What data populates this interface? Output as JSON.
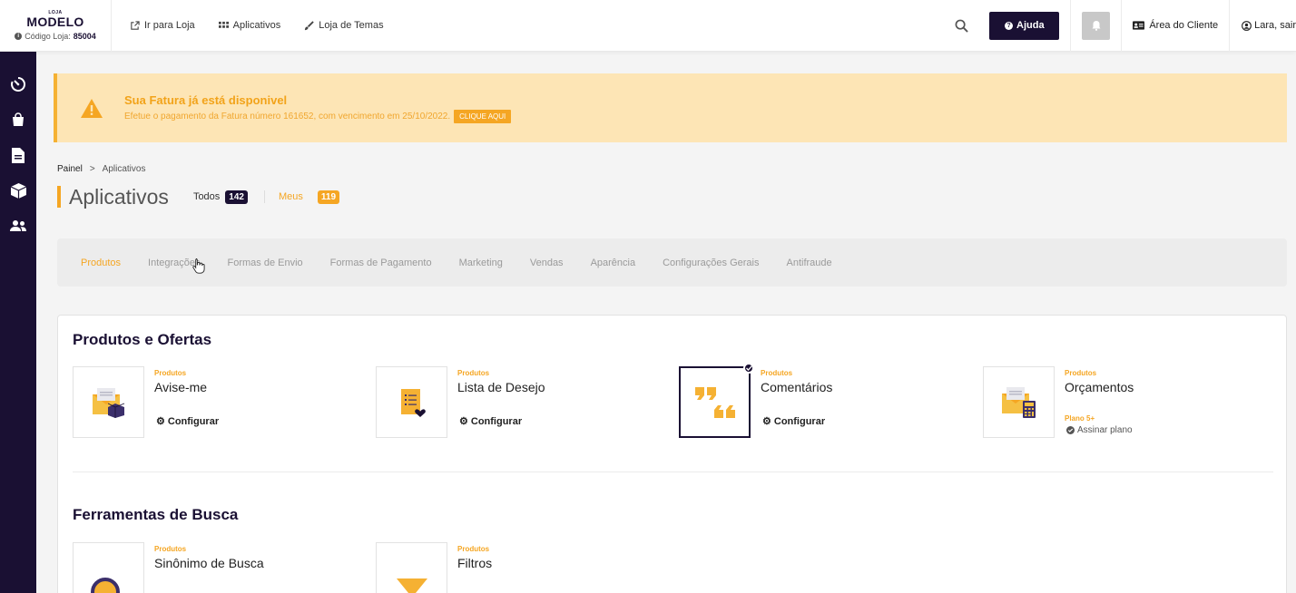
{
  "brand": {
    "small": "LOJA",
    "name": "MODELO",
    "code_label": "Código Loja:",
    "code_value": "85004"
  },
  "nav": [
    {
      "label": "Ir para Loja",
      "icon": "external-link-icon"
    },
    {
      "label": "Aplicativos",
      "icon": "grid-icon"
    },
    {
      "label": "Loja de Temas",
      "icon": "brush-icon"
    }
  ],
  "header": {
    "help_label": "Ajuda",
    "client_area_label": "Área do Cliente",
    "user_label": "Lara, sair"
  },
  "sidebar": {
    "icons": [
      "timer-icon",
      "shopping-bag-icon",
      "document-icon",
      "box-icon",
      "users-icon"
    ]
  },
  "alert": {
    "title": "Sua Fatura já está disponivel",
    "body": "Efetue o pagamento da Fatura número 161652, com vencimento em 25/10/2022.",
    "button": "CLIQUE AQUI"
  },
  "breadcrumb": {
    "home": "Painel",
    "separator": ">",
    "current": "Aplicativos"
  },
  "page": {
    "title": "Aplicativos",
    "all_label": "Todos",
    "all_count": "142",
    "mine_label": "Meus",
    "mine_count": "119"
  },
  "tabs": [
    "Produtos",
    "Integrações",
    "Formas de Envio",
    "Formas de Pagamento",
    "Marketing",
    "Vendas",
    "Aparência",
    "Configurações Gerais",
    "Antifraude"
  ],
  "sections": [
    {
      "title": "Produtos e Ofertas",
      "apps": [
        {
          "category": "Produtos",
          "name": "Avise-me",
          "action": "Configurar"
        },
        {
          "category": "Produtos",
          "name": "Lista de Desejo",
          "action": "Configurar"
        },
        {
          "category": "Produtos",
          "name": "Comentários",
          "action": "Configurar"
        },
        {
          "category": "Produtos",
          "name": "Orçamentos",
          "plan": "Plano 5+",
          "subscribe": "Assinar plano"
        }
      ]
    },
    {
      "title": "Ferramentas de Busca",
      "apps": [
        {
          "category": "Produtos",
          "name": "Sinônimo de Busca"
        },
        {
          "category": "Produtos",
          "name": "Filtros"
        }
      ]
    }
  ],
  "colors": {
    "brand_dark": "#1a1033",
    "accent": "#f5a623",
    "alert_bg": "#fde5b5"
  }
}
